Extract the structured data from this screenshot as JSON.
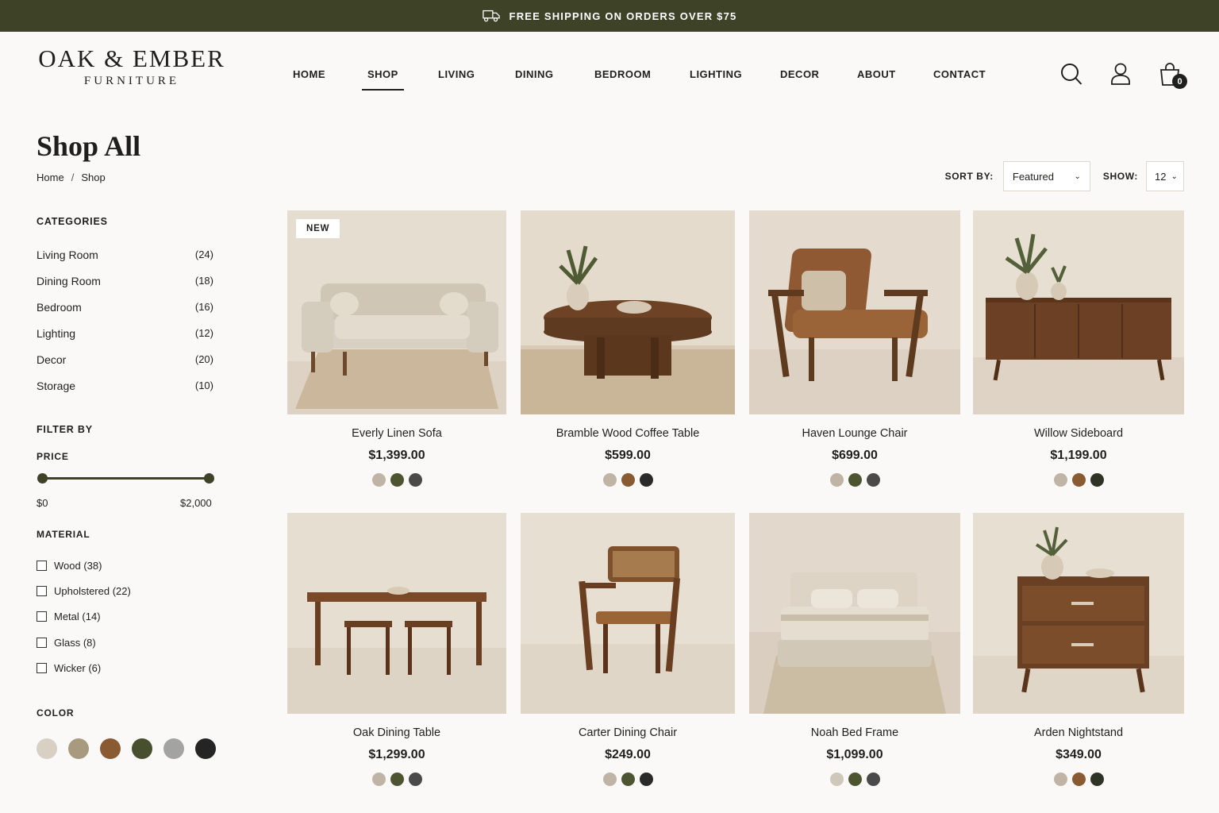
{
  "announcement": {
    "text": "FREE SHIPPING ON ORDERS OVER $75",
    "icon": "truck-icon"
  },
  "brand": {
    "name": "OAK & EMBER",
    "tagline": "FURNITURE"
  },
  "nav": {
    "items": [
      {
        "label": "HOME"
      },
      {
        "label": "SHOP",
        "active": true
      },
      {
        "label": "LIVING"
      },
      {
        "label": "DINING"
      },
      {
        "label": "BEDROOM"
      },
      {
        "label": "LIGHTING"
      },
      {
        "label": "DECOR"
      },
      {
        "label": "ABOUT"
      },
      {
        "label": "CONTACT"
      }
    ]
  },
  "header_icons": {
    "search": "search-icon",
    "account": "user-icon",
    "cart": "shopping-bag-icon",
    "cart_count": "0"
  },
  "page": {
    "title": "Shop All",
    "breadcrumb": [
      "Home",
      "/",
      "Shop"
    ]
  },
  "toolbar": {
    "sort_label": "SORT BY:",
    "sort_value": "Featured",
    "show_label": "SHOW:",
    "show_value": "12"
  },
  "sidebar": {
    "categories_heading": "CATEGORIES",
    "categories": [
      {
        "name": "Living Room",
        "count": "(24)"
      },
      {
        "name": "Dining Room",
        "count": "(18)"
      },
      {
        "name": "Bedroom",
        "count": "(16)"
      },
      {
        "name": "Lighting",
        "count": "(12)"
      },
      {
        "name": "Decor",
        "count": "(20)"
      },
      {
        "name": "Storage",
        "count": "(10)"
      }
    ],
    "filter_heading": "FILTER BY",
    "price_heading": "PRICE",
    "price_min": "$0",
    "price_max": "$2,000",
    "material_heading": "MATERIAL",
    "materials": [
      {
        "label": "Wood (38)",
        "checked": false
      },
      {
        "label": "Upholstered (22)",
        "checked": false
      },
      {
        "label": "Metal (14)",
        "checked": false
      },
      {
        "label": "Glass (8)",
        "checked": false
      },
      {
        "label": "Wicker (6)",
        "checked": false
      }
    ],
    "color_heading": "COLOR",
    "colors": [
      "#d8d0c3",
      "#a89a7e",
      "#8a5a32",
      "#474f2e",
      "#a3a3a1",
      "#242424"
    ]
  },
  "products": [
    {
      "name": "Everly Linen Sofa",
      "price": "$1,399.00",
      "badge": "NEW",
      "swatches": [
        "#bfb4a5",
        "#4d5530",
        "#4a4a4a"
      ]
    },
    {
      "name": "Bramble Wood Coffee Table",
      "price": "$599.00",
      "badge": "",
      "swatches": [
        "#bfb4a5",
        "#8a5a32",
        "#2a2a2a"
      ]
    },
    {
      "name": "Haven Lounge Chair",
      "price": "$699.00",
      "badge": "",
      "swatches": [
        "#bfb4a5",
        "#4d5530",
        "#4a4a4a"
      ]
    },
    {
      "name": "Willow Sideboard",
      "price": "$1,199.00",
      "badge": "",
      "swatches": [
        "#bfb4a5",
        "#8a5a32",
        "#2f3325"
      ]
    },
    {
      "name": "Oak Dining Table",
      "price": "$1,299.00",
      "badge": "",
      "swatches": [
        "#bfb4a5",
        "#4d5530",
        "#4a4a4a"
      ]
    },
    {
      "name": "Carter Dining Chair",
      "price": "$249.00",
      "badge": "",
      "swatches": [
        "#bfb4a5",
        "#4d5530",
        "#2a2a2a"
      ]
    },
    {
      "name": "Noah Bed Frame",
      "price": "$1,099.00",
      "badge": "",
      "swatches": [
        "#cfc7b9",
        "#4d5530",
        "#4a4a4a"
      ]
    },
    {
      "name": "Arden Nightstand",
      "price": "$349.00",
      "badge": "",
      "swatches": [
        "#bfb4a5",
        "#8a5a32",
        "#2f3325"
      ]
    }
  ]
}
